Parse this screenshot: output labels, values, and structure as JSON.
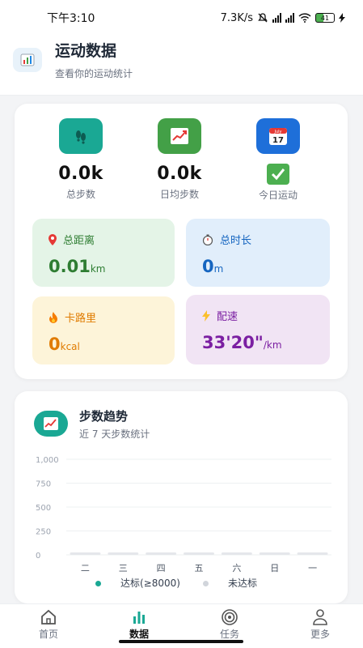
{
  "status": {
    "time": "下午3:10",
    "net": "7.3K/s",
    "battery": "41"
  },
  "header": {
    "icon": "bar-chart-icon",
    "title": "运动数据",
    "subtitle": "查看你的运动统计"
  },
  "summary": [
    {
      "icon": "footprints-icon",
      "value": "0.0k",
      "label": "总步数",
      "color": "#1aa894"
    },
    {
      "icon": "trend-chart-icon",
      "value": "0.0k",
      "label": "日均步数",
      "color": "#43a047"
    },
    {
      "icon": "calendar-icon",
      "value": "",
      "label": "今日运动",
      "color": "#1e6fd9",
      "calendar_month": "July",
      "calendar_day": "17",
      "done_icon": "check-mark-icon"
    }
  ],
  "tiles": [
    {
      "icon": "pin-icon",
      "title": "总距离",
      "value": "0.01",
      "unit": "km",
      "bg": "#e4f4e7",
      "fg": "#2e7d32"
    },
    {
      "icon": "stopwatch-icon",
      "title": "总时长",
      "value": "0",
      "unit": "m",
      "bg": "#e1eefb",
      "fg": "#1565c0"
    },
    {
      "icon": "fire-icon",
      "title": "卡路里",
      "value": "0",
      "unit": "kcal",
      "bg": "#fdf4d9",
      "fg": "#e07b00"
    },
    {
      "icon": "lightning-icon",
      "title": "配速",
      "value": "33'20\"",
      "unit": "/km",
      "bg": "#f1e4f4",
      "fg": "#7b1fa2"
    }
  ],
  "trend": {
    "icon": "trend-chart-icon",
    "title": "步数趋势",
    "subtitle": "近 7 天步数统计",
    "legend": [
      {
        "label": "达标(≥8000)",
        "color": "#1aa894"
      },
      {
        "label": "未达标",
        "color": "#d1d5db"
      }
    ]
  },
  "chart_data": {
    "type": "bar",
    "categories": [
      "二",
      "三",
      "四",
      "五",
      "六",
      "日",
      "一"
    ],
    "values": [
      0,
      0,
      0,
      0,
      0,
      0,
      0
    ],
    "ylim": [
      0,
      1000
    ],
    "yticks": [
      "0",
      "250",
      "500",
      "750",
      "1,000"
    ],
    "grid": true,
    "legend_position": "bottom"
  },
  "nav": [
    {
      "icon": "home-icon",
      "label": "首页",
      "active": false
    },
    {
      "icon": "data-icon",
      "label": "数据",
      "active": true
    },
    {
      "icon": "target-icon",
      "label": "任务",
      "active": false
    },
    {
      "icon": "user-icon",
      "label": "更多",
      "active": false
    }
  ]
}
